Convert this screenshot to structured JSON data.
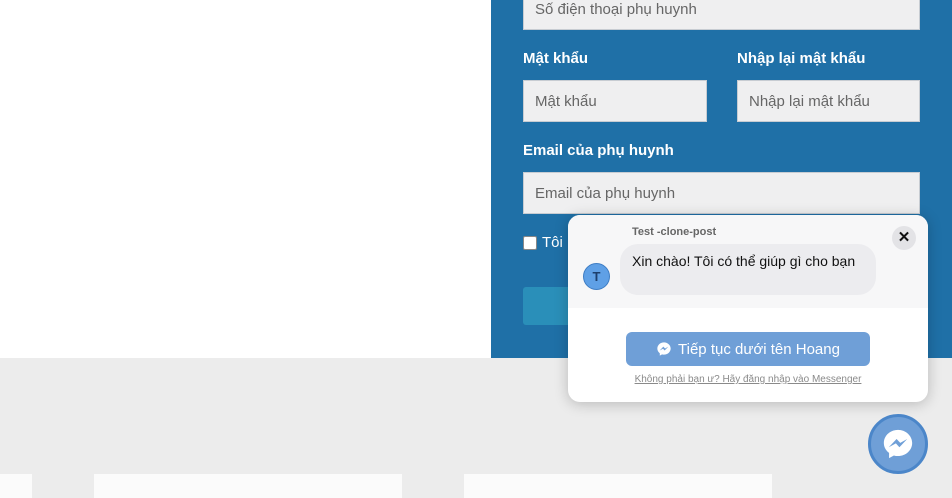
{
  "form": {
    "phone_placeholder": "Số điện thoại phụ huynh",
    "password_label": "Mật khẩu",
    "password_placeholder": "Mật khẩu",
    "repassword_label": "Nhập lại mật khẩu",
    "repassword_placeholder": "Nhập lại mật khẩu",
    "email_label": "Email của phụ huynh",
    "email_placeholder": "Email của phụ huynh",
    "agree_text": "Tôi"
  },
  "chat": {
    "page_name": "Test -clone-post",
    "avatar_letter": "T",
    "message": "Xin chào! Tôi có thể giúp gì cho bạn",
    "close_label": "✕",
    "continue_label": "Tiếp tục dưới tên Hoang",
    "login_link": "Không phải bạn ư? Hãy đăng nhập vào Messenger"
  },
  "colors": {
    "panel_blue": "#1f70a7",
    "messenger_blue": "#6f9fd7"
  },
  "icons": {
    "continue": "messenger-icon",
    "fab": "messenger-icon",
    "close": "close-icon"
  }
}
